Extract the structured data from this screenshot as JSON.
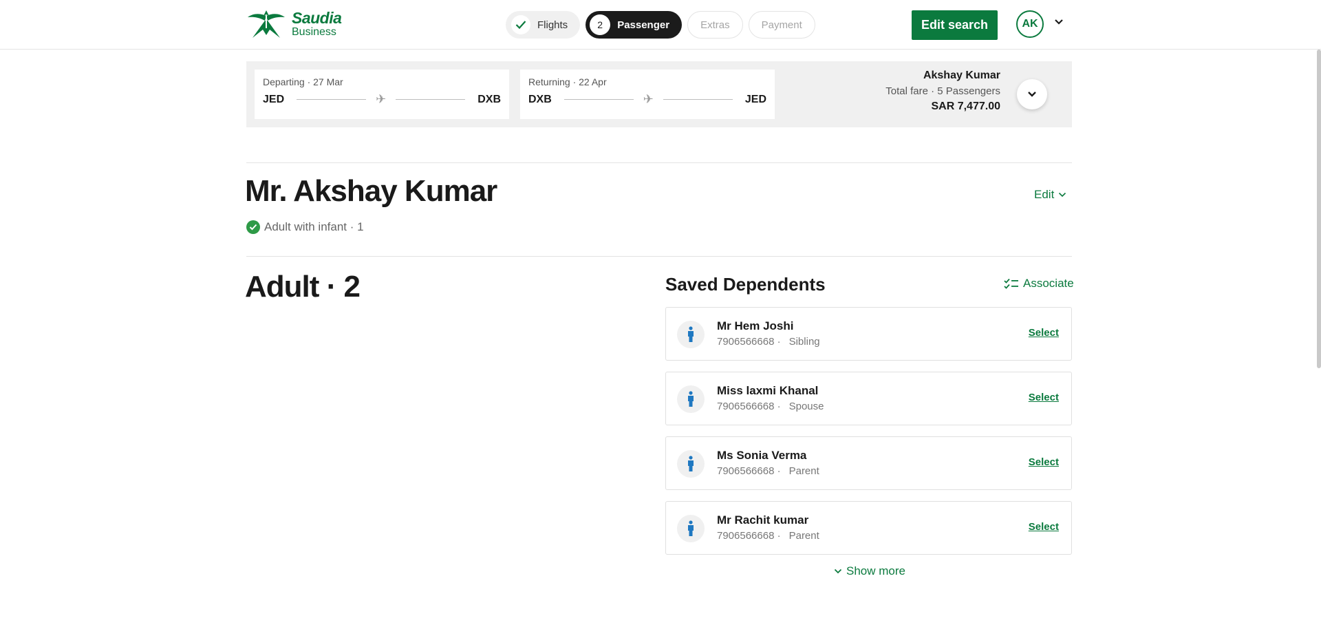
{
  "brand": {
    "line1": "Saudia",
    "line2": "Business"
  },
  "steps": [
    {
      "label": "Flights",
      "state": "done"
    },
    {
      "label": "Passenger",
      "number": "2",
      "state": "active"
    },
    {
      "label": "Extras",
      "state": "upcoming"
    },
    {
      "label": "Payment",
      "state": "upcoming"
    }
  ],
  "header": {
    "edit_search": "Edit search",
    "avatar_initials": "AK"
  },
  "trip": {
    "departing": {
      "label": "Departing · 27 Mar",
      "from": "JED",
      "to": "DXB"
    },
    "returning": {
      "label": "Returning · 22 Apr",
      "from": "DXB",
      "to": "JED"
    },
    "fare": {
      "name": "Akshay Kumar",
      "sub": "Total fare · 5 Passengers",
      "amount": "SAR 7,477.00"
    }
  },
  "passenger": {
    "name": "Mr. Akshay Kumar",
    "type": "Adult with infant · 1",
    "edit": "Edit"
  },
  "section": {
    "title": "Adult · 2"
  },
  "dependents": {
    "title": "Saved Dependents",
    "associate": "Associate",
    "select_label": "Select",
    "show_more": "Show more",
    "items": [
      {
        "name": "Mr Hem Joshi",
        "phone": "7906566668 ·",
        "relation": "Sibling"
      },
      {
        "name": "Miss laxmi Khanal",
        "phone": "7906566668 ·",
        "relation": "Spouse"
      },
      {
        "name": "Ms Sonia Verma",
        "phone": "7906566668 ·",
        "relation": "Parent"
      },
      {
        "name": "Mr Rachit kumar",
        "phone": "7906566668 ·",
        "relation": "Parent"
      }
    ]
  },
  "colors": {
    "brand_green": "#0b7a3e",
    "active_step": "#1b1b1b",
    "person_icon": "#1f78c1",
    "ok_green": "#2e9a47"
  }
}
